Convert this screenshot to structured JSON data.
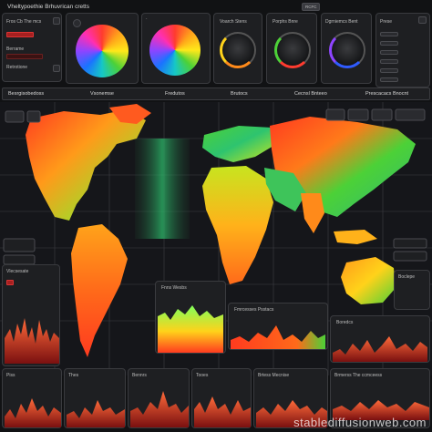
{
  "header": {
    "title": "Vheltypoethie Brhuvrican cretts",
    "badge": "RCFC"
  },
  "top_panels": {
    "left_list": [
      "Fros Cb The mcs",
      "",
      "Berrame",
      "Retrotione"
    ],
    "knob_titles": [
      "Voarch Stens",
      "Porphs Bnre",
      "Dgrniemcs Bent"
    ],
    "right_list": [
      "Prese",
      "",
      "",
      "",
      "",
      "",
      "",
      "",
      ""
    ]
  },
  "tabs": [
    "Besrgisobedoss",
    "Vsonemse",
    "Fredutos",
    "Brutocs",
    "Cecnsl Bnteeo",
    "Prescacacs Bnocnt"
  ],
  "side_panels": {
    "left_panel_title": "Vlecsesate",
    "mid_panel_title": "Fnns Wesbs",
    "right_panel_title": "Boclepe"
  },
  "bottom_charts": [
    "Piss",
    "Thes",
    "Bennrs",
    "Tooes",
    "Brtess Mecnise",
    "Brmerss The ccmceess"
  ],
  "mid_charts": {
    "chart_a": "Fmrcesses Psstacs",
    "chart_b": "Boredcs"
  },
  "watermark": "stablediffusionweb.com",
  "colors": {
    "accent": "#ff3b2f",
    "bg": "#111214",
    "panel": "#1e1f22"
  }
}
